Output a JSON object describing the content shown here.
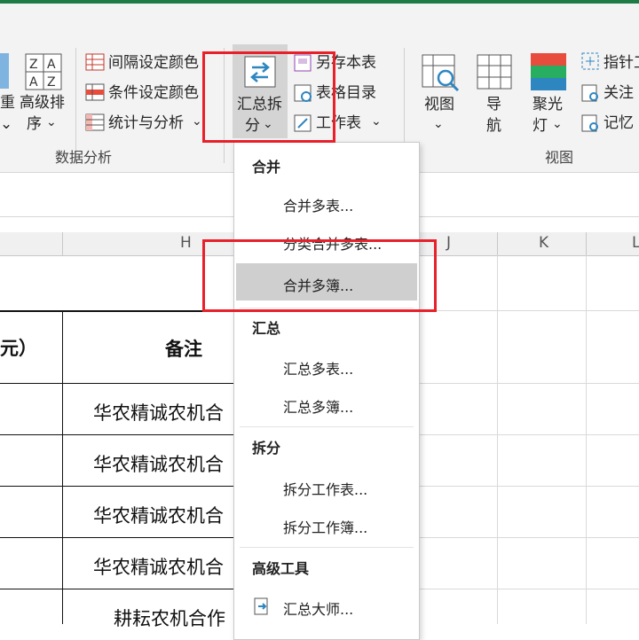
{
  "ribbon": {
    "partial_left_label": "重",
    "sort_label_line1": "高级排",
    "sort_label_line2": "序",
    "interval_color_label": "间隔设定颜色",
    "condition_color_label": "条件设定颜色",
    "stats_label": "统计与分析",
    "data_group_label": "数据分析",
    "split_merge_line1": "汇总拆",
    "split_merge_line2": "分",
    "save_sheet_label": "另存本表",
    "sheet_dir_label": "表格目录",
    "worksheet_label": "工作表",
    "view_label": "视图",
    "nav_label_line1": "导",
    "nav_label_line2": "航",
    "spotlight_line1": "聚光",
    "spotlight_line2": "灯",
    "pointer_label": "指针工",
    "follow_label": "关注",
    "memo_label": "记忆",
    "view_group_label": "视图",
    "chevron": "⌄"
  },
  "columns": {
    "h": "H",
    "j": "J",
    "k": "K",
    "l": "L"
  },
  "sheet": {
    "header_partial": "元）",
    "header_note": "备注",
    "rows": [
      "华农精诚农机合",
      "华农精诚农机合",
      "华农精诚农机合",
      "华农精诚农机合",
      "耕耘农机合作"
    ]
  },
  "menu": {
    "section_merge": "合并",
    "merge_sheets": "合并多表...",
    "classify_merge": "分类合并多表...",
    "merge_books": "合并多簿...",
    "section_summary": "汇总",
    "summary_sheets": "汇总多表...",
    "summary_books": "汇总多簿...",
    "section_split": "拆分",
    "split_sheet": "拆分工作表...",
    "split_book": "拆分工作簿...",
    "section_advanced": "高级工具",
    "summary_master": "汇总大师..."
  },
  "colors": {
    "accent_green": "#1e7b45",
    "highlight_red": "#e8202a",
    "hover_gray": "#cfcfcf"
  }
}
